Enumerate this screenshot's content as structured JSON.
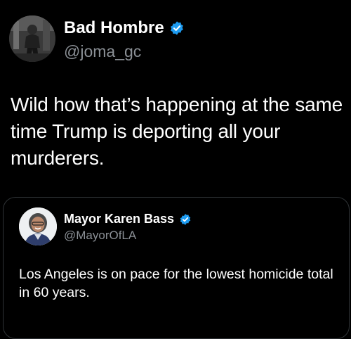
{
  "tweet": {
    "author_name": "Bad Hombre",
    "author_handle": "@joma_gc",
    "text": "Wild how that’s happening at the same time Trump is deporting all your murderers.",
    "verified_color": "#1d9bf0"
  },
  "quoted_tweet": {
    "author_name": "Mayor Karen Bass",
    "author_handle": "@MayorOfLA",
    "text": "Los Angeles is on pace for the lowest homicide total in 60 years.",
    "verified_color": "#1d9bf0"
  },
  "colors": {
    "background": "#000000",
    "text_primary": "#ffffff",
    "text_secondary": "#8b9096",
    "border": "#2f3336"
  },
  "icons": {
    "verified": "verified-badge-icon"
  }
}
